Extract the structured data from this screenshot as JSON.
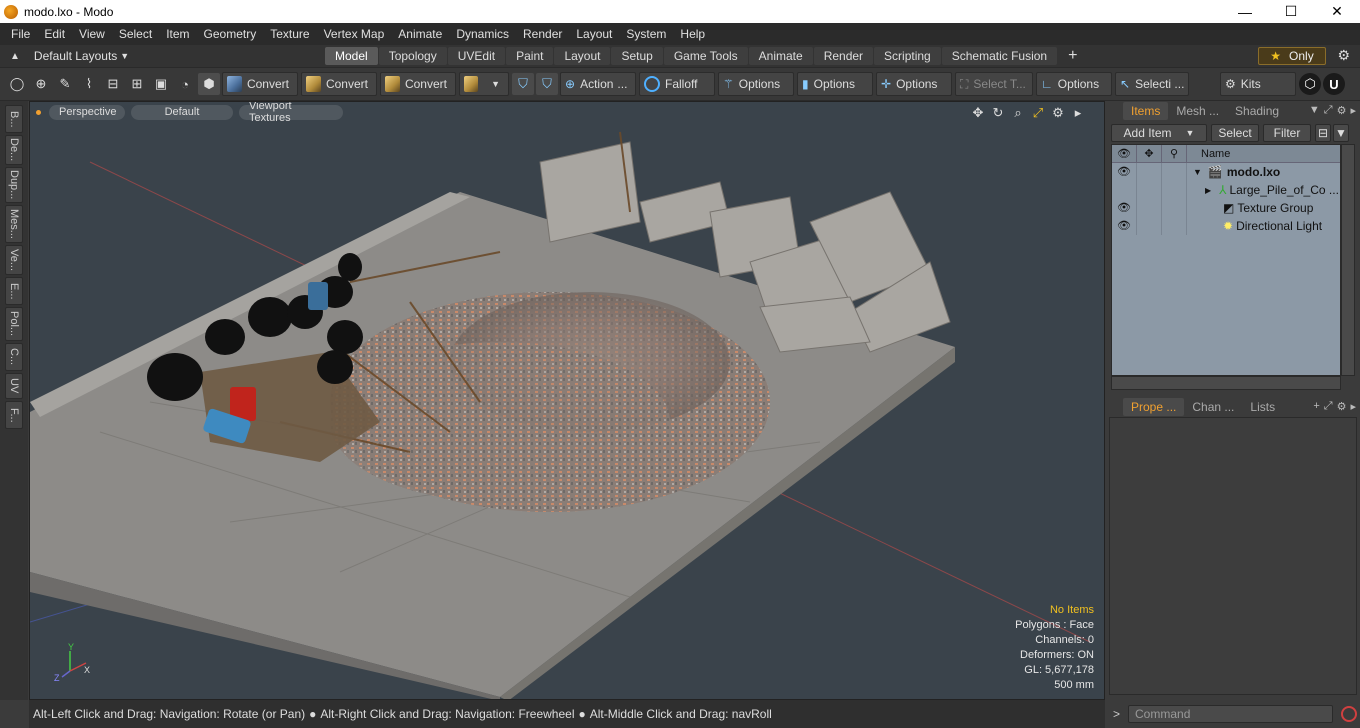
{
  "window": {
    "title": "modo.lxo - Modo",
    "min": "—",
    "max": "☐",
    "close": "✕"
  },
  "menu": [
    "File",
    "Edit",
    "View",
    "Select",
    "Item",
    "Geometry",
    "Texture",
    "Vertex Map",
    "Animate",
    "Dynamics",
    "Render",
    "Layout",
    "System",
    "Help"
  ],
  "layouts": {
    "label": "Default Layouts"
  },
  "tabs": [
    "Model",
    "Topology",
    "UVEdit",
    "Paint",
    "Layout",
    "Setup",
    "Game Tools",
    "Animate",
    "Render",
    "Scripting",
    "Schematic Fusion"
  ],
  "active_tab": "Model",
  "only_label": "Only",
  "toolbar": {
    "convert": "Convert",
    "action": "Action",
    "falloff": "Falloff",
    "options": "Options",
    "select_t": "Select T...",
    "selecti": "Selecti ...",
    "kits": "Kits"
  },
  "left_tabs": [
    "B...",
    "De...",
    "Dup...",
    "Mes...",
    "Ve...",
    "E...",
    "Pol...",
    "C...",
    "UV",
    "F..."
  ],
  "viewport": {
    "view": "Perspective",
    "style": "Default",
    "shading": "Viewport Textures",
    "info": {
      "no_items": "No Items",
      "polygons": "Polygons : Face",
      "channels": "Channels: 0",
      "deformers": "Deformers: ON",
      "gl": "GL: 5,677,178",
      "scale": "500 mm"
    },
    "axes": {
      "x": "X",
      "y": "Y",
      "z": "Z"
    }
  },
  "status": {
    "hint1": "Alt-Left Click and Drag: Navigation: Rotate (or Pan)",
    "hint2": "Alt-Right Click and Drag: Navigation: Freewheel",
    "hint3": "Alt-Middle Click and Drag: navRoll"
  },
  "right_panel": {
    "tabs": [
      "Items",
      "Mesh ...",
      "Shading"
    ],
    "add_item": "Add Item",
    "select": "Select",
    "filter": "Filter",
    "name_header": "Name",
    "items": [
      {
        "label": "modo.lxo",
        "indent": 0
      },
      {
        "label": "Large_Pile_of_Co ...",
        "indent": 1
      },
      {
        "label": "Texture Group",
        "indent": 1
      },
      {
        "label": "Directional Light",
        "indent": 1
      }
    ],
    "lower_tabs": [
      "Prope ...",
      "Chan ...",
      "Lists"
    ],
    "command_placeholder": "Command"
  },
  "colors": {
    "accent": "#f0a030",
    "viewport_bg": "#3a434b",
    "items_bg": "#8c99a6"
  }
}
